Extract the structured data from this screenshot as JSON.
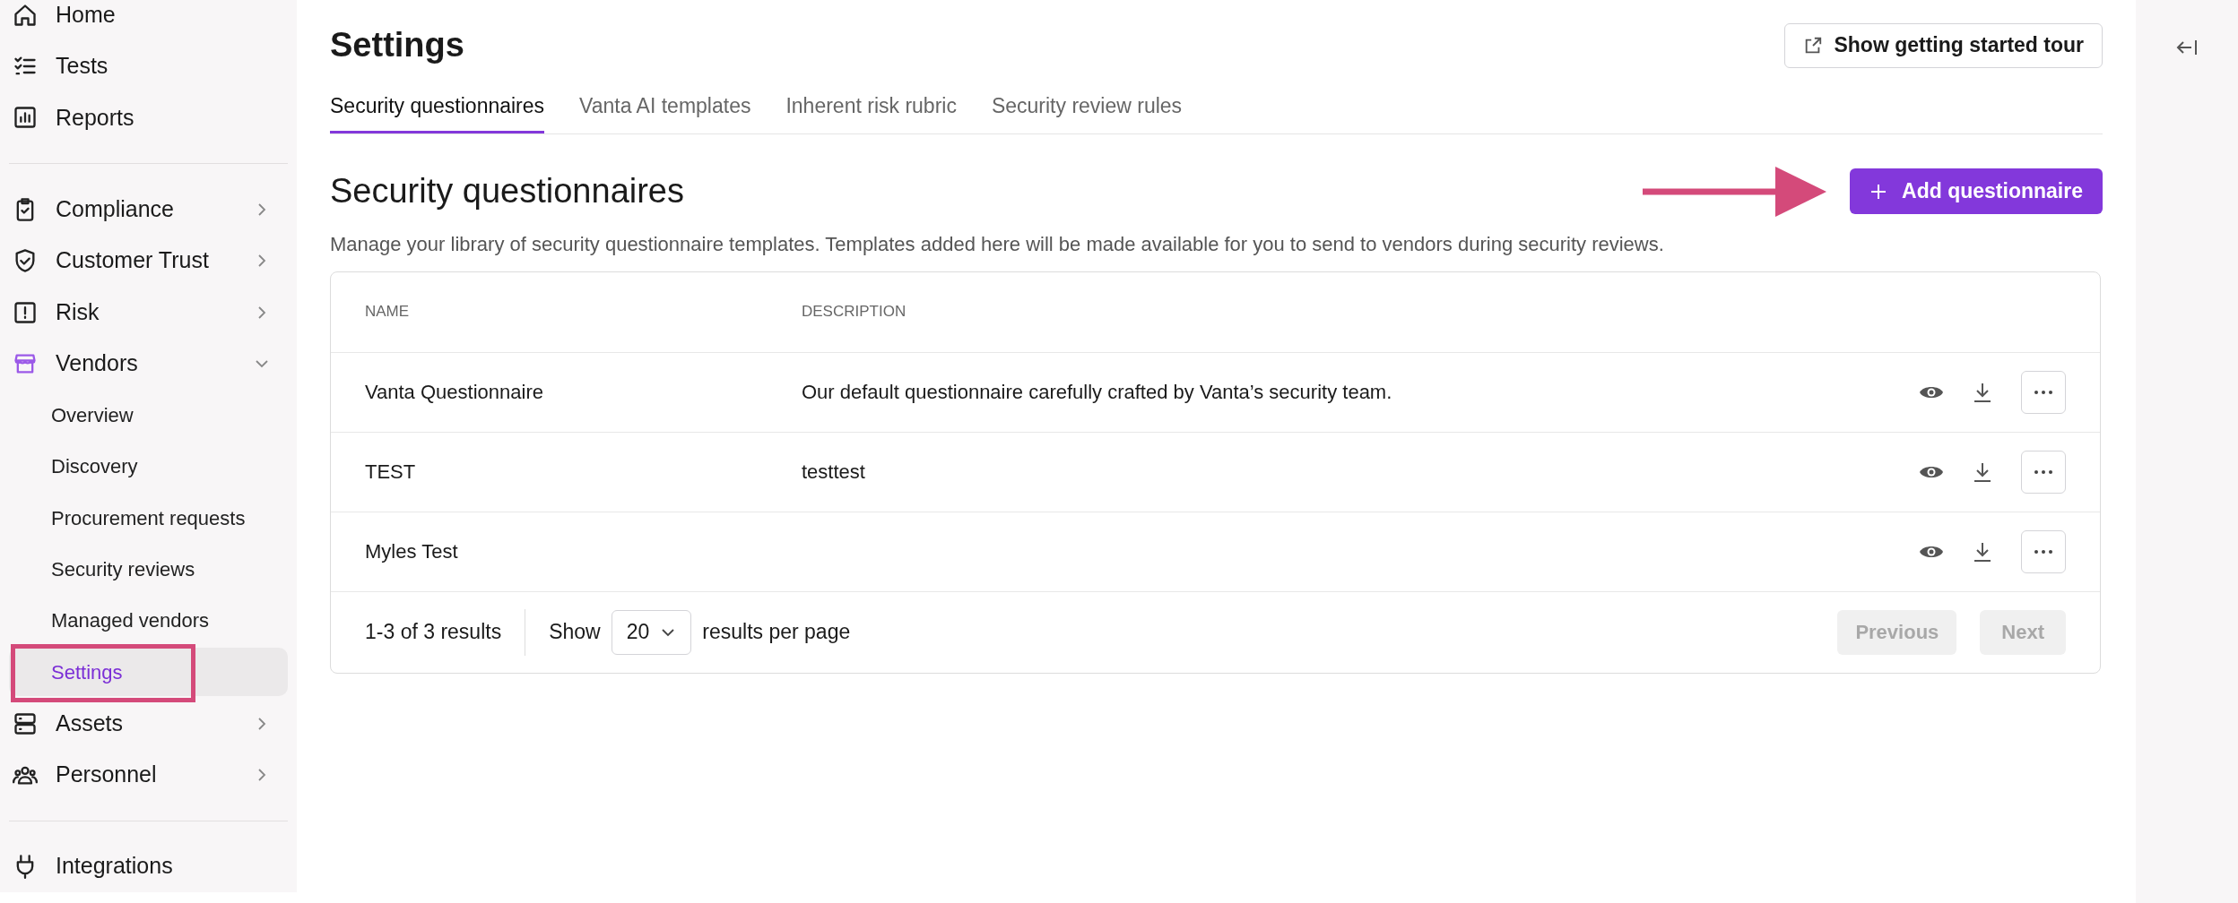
{
  "sidebar": {
    "groups": [
      {
        "items": [
          {
            "label": "Home",
            "kind": "link"
          },
          {
            "label": "Tests",
            "kind": "link"
          },
          {
            "label": "Reports",
            "kind": "link"
          }
        ]
      },
      {
        "items": [
          {
            "label": "Compliance",
            "kind": "group",
            "expanded": false
          },
          {
            "label": "Customer Trust",
            "kind": "group",
            "expanded": false
          },
          {
            "label": "Risk",
            "kind": "group",
            "expanded": false
          },
          {
            "label": "Vendors",
            "kind": "group",
            "expanded": true,
            "children": [
              {
                "label": "Overview",
                "selected": false
              },
              {
                "label": "Discovery",
                "selected": false
              },
              {
                "label": "Procurement requests",
                "selected": false
              },
              {
                "label": "Security reviews",
                "selected": false
              },
              {
                "label": "Managed vendors",
                "selected": false
              },
              {
                "label": "Settings",
                "selected": true
              }
            ]
          },
          {
            "label": "Assets",
            "kind": "group",
            "expanded": false
          },
          {
            "label": "Personnel",
            "kind": "group",
            "expanded": false
          }
        ]
      },
      {
        "items": [
          {
            "label": "Integrations",
            "kind": "link"
          }
        ]
      }
    ]
  },
  "page": {
    "title": "Settings",
    "tour_button": "Show getting started tour"
  },
  "tabs": [
    {
      "label": "Security questionnaires",
      "selected": true
    },
    {
      "label": "Vanta AI templates",
      "selected": false
    },
    {
      "label": "Inherent risk rubric",
      "selected": false
    },
    {
      "label": "Security review rules",
      "selected": false
    }
  ],
  "section": {
    "title": "Security questionnaires",
    "add_button": "Add questionnaire",
    "description": "Manage your library of security questionnaire templates. Templates added here will be made available for you to send to vendors during security reviews."
  },
  "table": {
    "columns": [
      "NAME",
      "DESCRIPTION"
    ],
    "rows": [
      {
        "name": "Vanta Questionnaire",
        "description": "Our default questionnaire carefully crafted by Vanta’s security team."
      },
      {
        "name": "TEST",
        "description": "testtest"
      },
      {
        "name": "Myles Test"
      }
    ],
    "footer": {
      "summary": "1-3 of 3 results",
      "show_label": "Show",
      "page_size": "20",
      "per_page_label": "results per page",
      "previous": {
        "label": "Previous",
        "disabled": true
      },
      "next": {
        "label": "Next",
        "disabled": true
      }
    }
  }
}
